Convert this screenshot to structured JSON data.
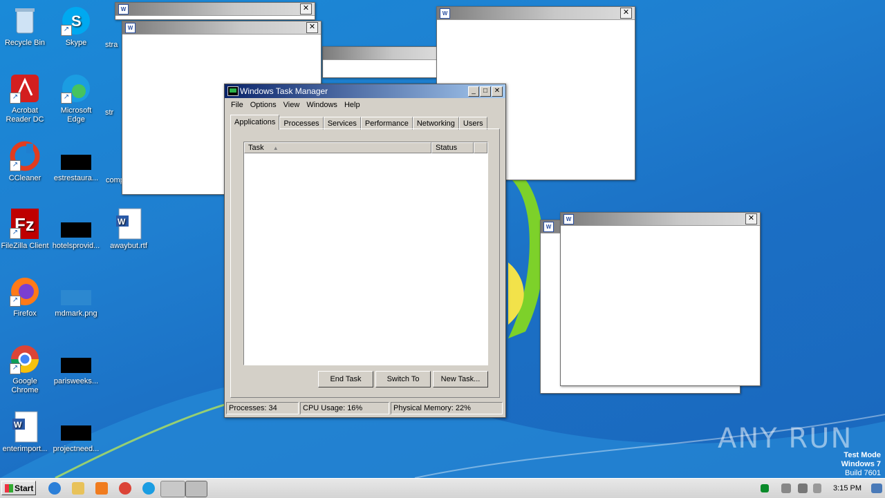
{
  "desktop": {
    "icons": [
      {
        "label": "Recycle Bin"
      },
      {
        "label": "Skype"
      },
      {
        "label": "Acrobat Reader DC"
      },
      {
        "label": "Microsoft Edge"
      },
      {
        "label": "CCleaner"
      },
      {
        "label": "estrestaura..."
      },
      {
        "label": "FileZilla Client"
      },
      {
        "label": "hotelsprovid..."
      },
      {
        "label": "awaybut.rtf"
      },
      {
        "label": "Firefox"
      },
      {
        "label": "mdmark.png"
      },
      {
        "label": "Google Chrome"
      },
      {
        "label": "parisweeks..."
      },
      {
        "label": "enterimport..."
      },
      {
        "label": "projectneed..."
      }
    ],
    "partial_labels": [
      "stra",
      "str",
      "str",
      "comp"
    ]
  },
  "task_manager": {
    "title": "Windows Task Manager",
    "menu": [
      "File",
      "Options",
      "View",
      "Windows",
      "Help"
    ],
    "tabs": [
      "Applications",
      "Processes",
      "Services",
      "Performance",
      "Networking",
      "Users"
    ],
    "active_tab": "Applications",
    "columns": [
      "Task",
      "Status"
    ],
    "buttons": {
      "end_task": "End Task",
      "switch_to": "Switch To",
      "new_task": "New Task..."
    },
    "status": {
      "processes": "Processes: 34",
      "cpu": "CPU Usage: 16%",
      "memory": "Physical Memory: 22%"
    }
  },
  "taskbar": {
    "start_label": "Start",
    "clock": "3:15 PM"
  },
  "watermark": {
    "line1": "Test Mode",
    "line2": "Windows 7",
    "line3": "Build 7601",
    "brand": "ANY RUN"
  },
  "colors": {
    "desktop_bg": "#1f7fd0",
    "titlebar_active": "#0a246a",
    "window_face": "#d4d0c8"
  }
}
